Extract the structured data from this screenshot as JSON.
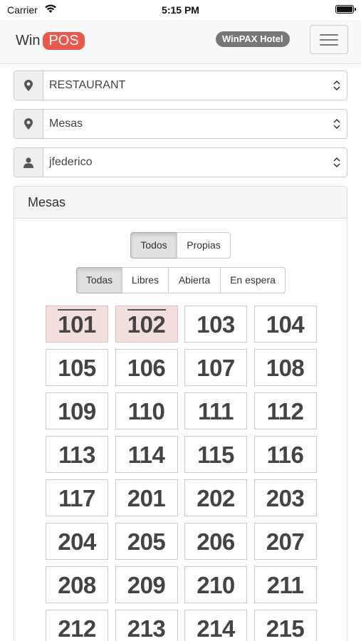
{
  "status_bar": {
    "carrier": "Carrier",
    "time": "5:15 PM"
  },
  "header": {
    "logo_win": "Win",
    "logo_pos": "POS",
    "hotel_badge": "WinPAX Hotel"
  },
  "selects": {
    "location": {
      "value": "RESTAURANT",
      "icon": "map-marker-icon"
    },
    "area": {
      "value": "Mesas",
      "icon": "map-marker-icon"
    },
    "user": {
      "value": "jfederico",
      "icon": "user-icon"
    }
  },
  "panel": {
    "title": "Mesas",
    "owner_filter": {
      "options": [
        "Todos",
        "Propias"
      ],
      "selected": "Todos"
    },
    "state_filter": {
      "options": [
        "Todas",
        "Libres",
        "Abierta",
        "En espera"
      ],
      "selected": "Todas"
    },
    "tables": [
      {
        "number": "101",
        "occupied": true
      },
      {
        "number": "102",
        "occupied": true
      },
      {
        "number": "103",
        "occupied": false
      },
      {
        "number": "104",
        "occupied": false
      },
      {
        "number": "105",
        "occupied": false
      },
      {
        "number": "106",
        "occupied": false
      },
      {
        "number": "107",
        "occupied": false
      },
      {
        "number": "108",
        "occupied": false
      },
      {
        "number": "109",
        "occupied": false
      },
      {
        "number": "110",
        "occupied": false
      },
      {
        "number": "111",
        "occupied": false
      },
      {
        "number": "112",
        "occupied": false
      },
      {
        "number": "113",
        "occupied": false
      },
      {
        "number": "114",
        "occupied": false
      },
      {
        "number": "115",
        "occupied": false
      },
      {
        "number": "116",
        "occupied": false
      },
      {
        "number": "117",
        "occupied": false
      },
      {
        "number": "201",
        "occupied": false
      },
      {
        "number": "202",
        "occupied": false
      },
      {
        "number": "203",
        "occupied": false
      },
      {
        "number": "204",
        "occupied": false
      },
      {
        "number": "205",
        "occupied": false
      },
      {
        "number": "206",
        "occupied": false
      },
      {
        "number": "207",
        "occupied": false
      },
      {
        "number": "208",
        "occupied": false
      },
      {
        "number": "209",
        "occupied": false
      },
      {
        "number": "210",
        "occupied": false
      },
      {
        "number": "211",
        "occupied": false
      },
      {
        "number": "212",
        "occupied": false
      },
      {
        "number": "213",
        "occupied": false
      },
      {
        "number": "214",
        "occupied": false
      },
      {
        "number": "215",
        "occupied": false
      }
    ]
  },
  "colors": {
    "brand": "#ea5a4c",
    "badge": "#777777",
    "occupied_tile": "#f3dede"
  }
}
